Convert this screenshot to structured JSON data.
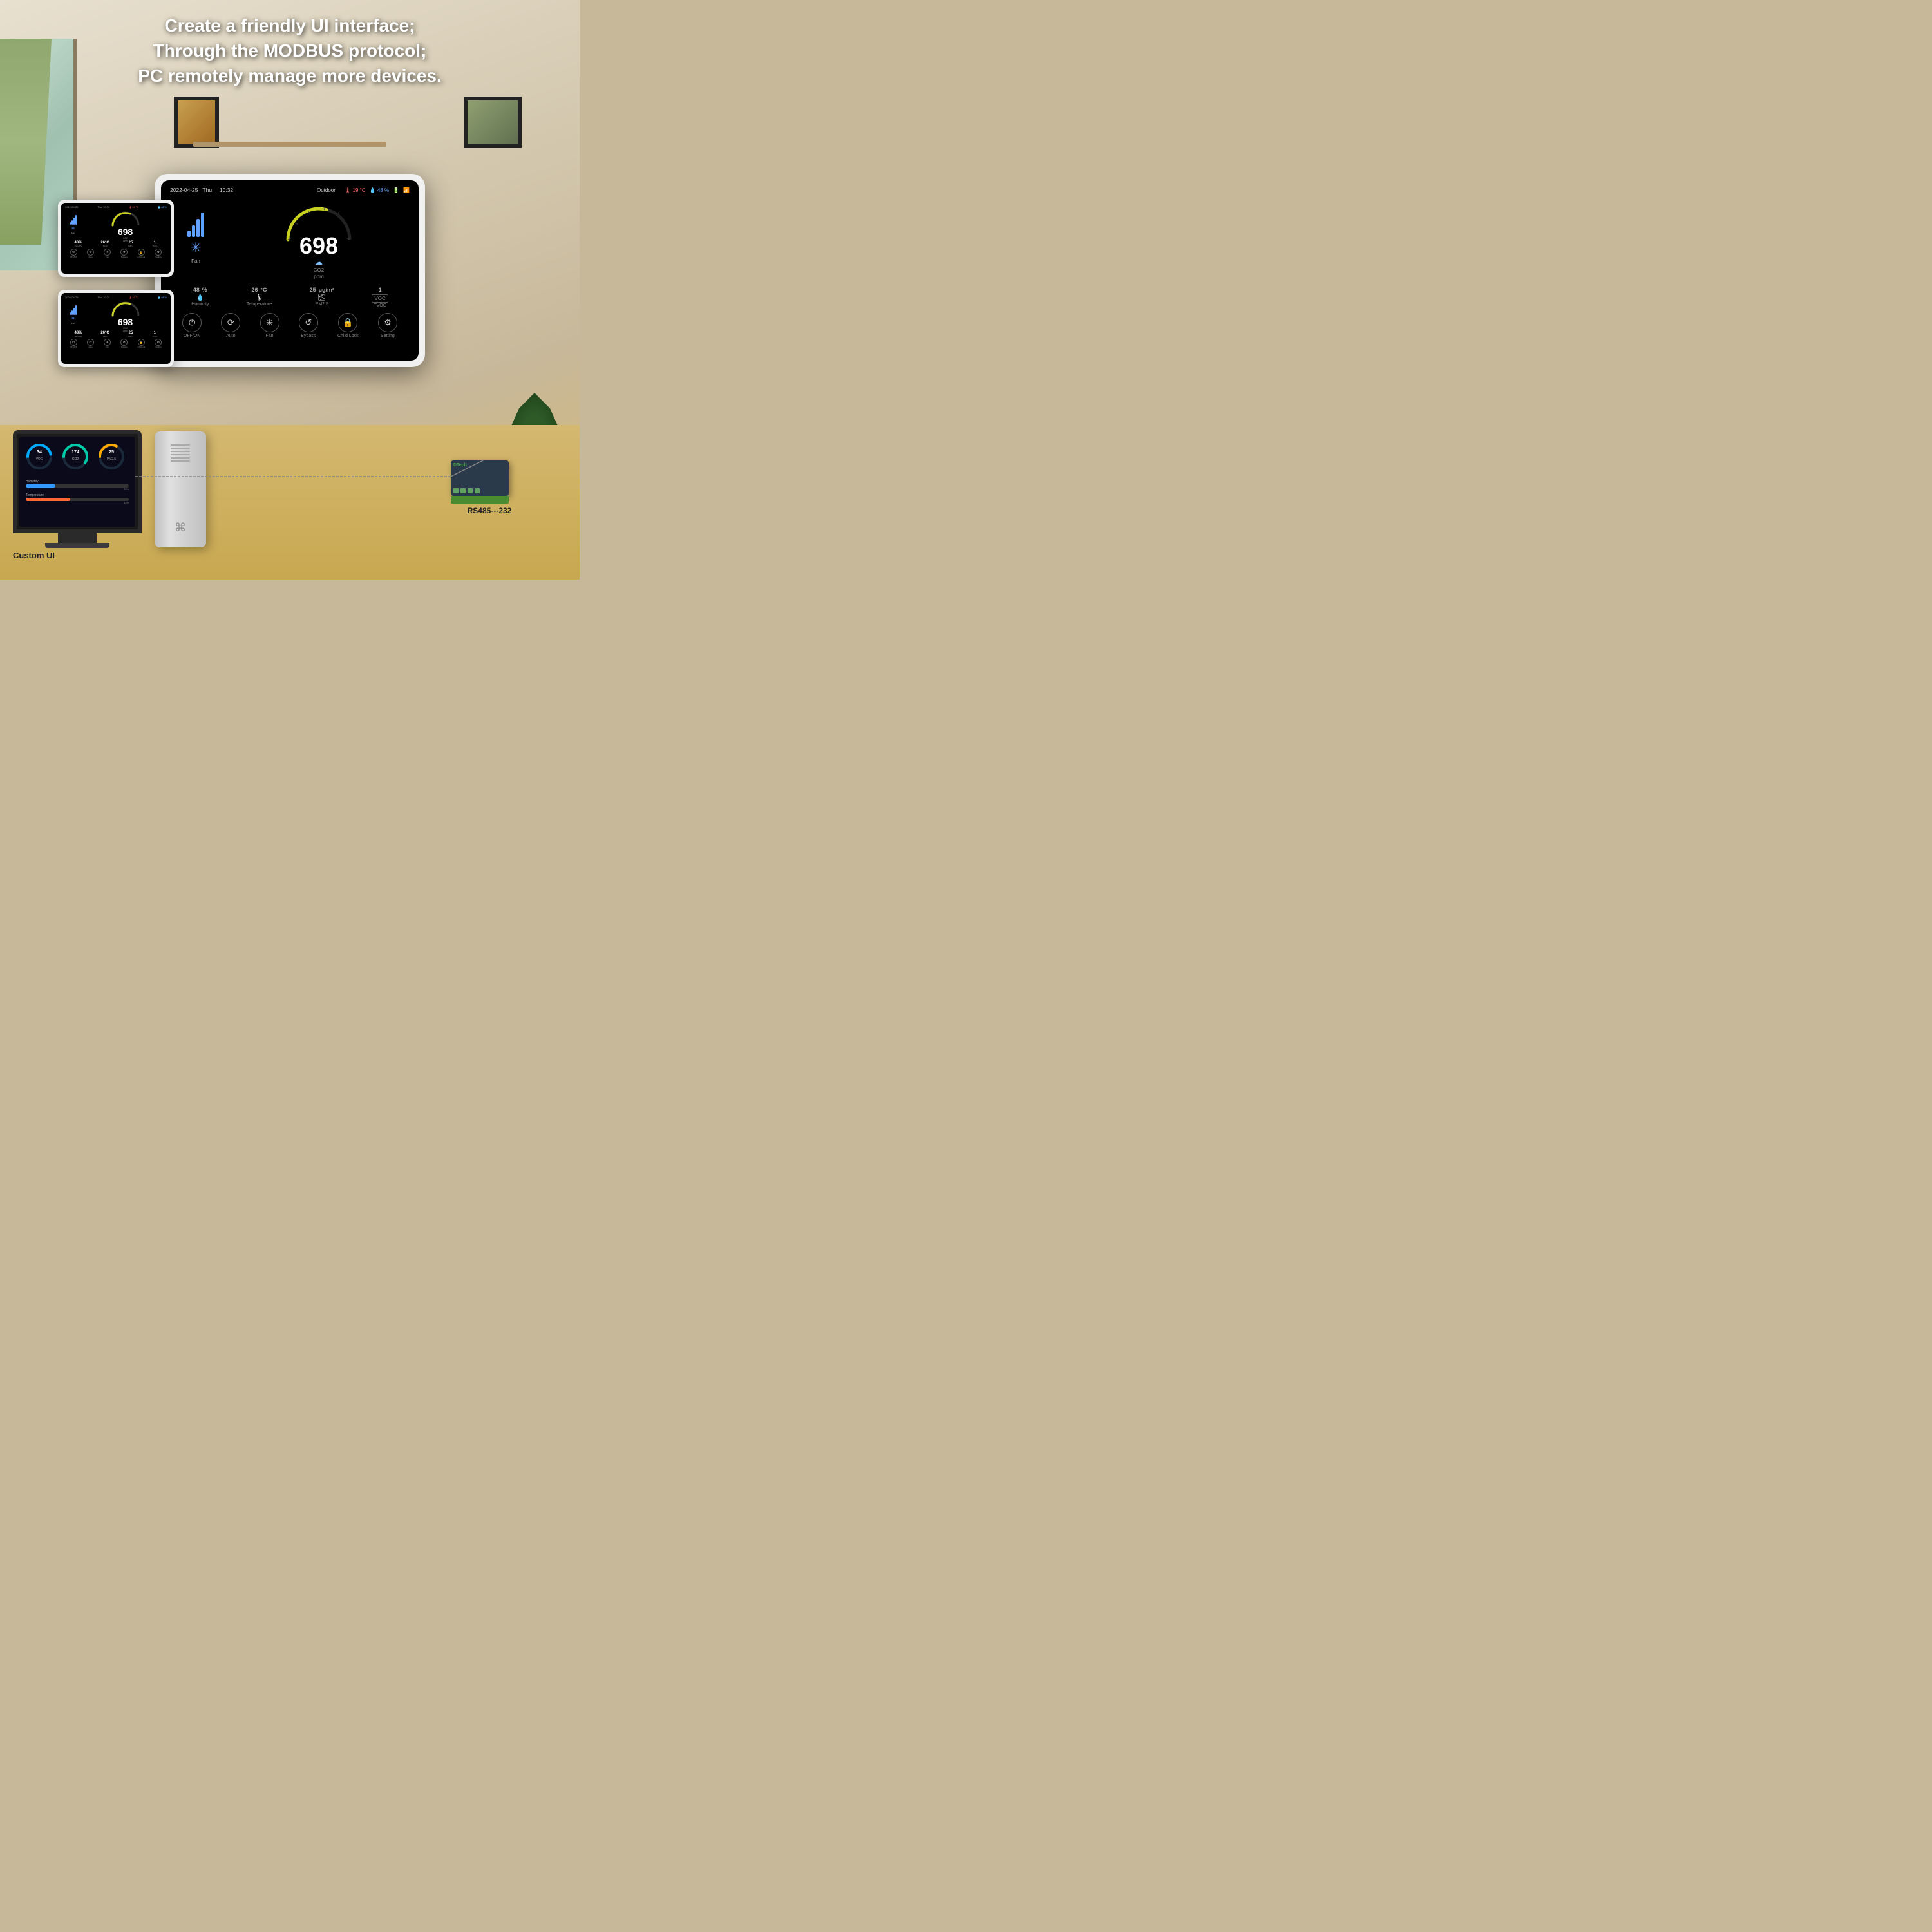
{
  "header": {
    "line1": "Create a friendly UI interface;",
    "line2": "Through the MODBUS protocol;",
    "line3": "PC remotely manage more devices."
  },
  "main_device": {
    "date": "2022-04-25",
    "day": "Thu.",
    "time": "10:32",
    "outdoor_label": "Outdoor",
    "outdoor_temp": "19 °C",
    "outdoor_humid": "48 %",
    "co2_value": "698",
    "co2_unit": "CO2",
    "co2_ppm": "ppm",
    "humidity_value": "48",
    "humidity_unit": "%",
    "humidity_label": "Humidity",
    "temp_value": "26",
    "temp_unit": "°C",
    "temp_label": "Temperature",
    "pm25_value": "25",
    "pm25_unit": "μg/m³",
    "pm25_label": "PM2.5",
    "tvoc_value": "1",
    "tvoc_label": "TVOC",
    "fan_label": "Fan",
    "controls": [
      {
        "icon": "⏻",
        "label": "OFF/ON"
      },
      {
        "icon": "⟳",
        "label": "Auto"
      },
      {
        "icon": "✳",
        "label": "Fan"
      },
      {
        "icon": "↺",
        "label": "Bypass"
      },
      {
        "icon": "🔒",
        "label": "Child Lock"
      },
      {
        "icon": "⚙",
        "label": "Setting"
      }
    ]
  },
  "small_device_1": {
    "date": "2022-04-25",
    "day": "Thu. 10:32",
    "outdoor_temp": "19 °C",
    "outdoor_humid": "48 %",
    "co2_value": "698",
    "humidity_value": "48",
    "temp_value": "26",
    "pm25_value": "25",
    "tvoc_value": "1"
  },
  "small_device_2": {
    "date": "2022-04-25",
    "day": "Thu. 10:32",
    "outdoor_temp": "19 °C",
    "outdoor_humid": "48 %",
    "co2_value": "698",
    "humidity_value": "48",
    "temp_value": "26",
    "pm25_value": "25",
    "tvoc_value": "1"
  },
  "bottom": {
    "custom_ui_label": "Custom UI",
    "rs485_label": "RS485---232",
    "mac_gauges": [
      {
        "label": "VOC",
        "value": "34",
        "color": "#00aaff"
      },
      {
        "label": "CO2",
        "value": "174",
        "color": "#00ccaa"
      },
      {
        "label": "PM2.5",
        "value": "25",
        "color": "#ffaa00"
      }
    ],
    "mac_metrics": [
      {
        "name": "Humidity",
        "value": "29%",
        "pct": 29,
        "color": "#3399ff"
      },
      {
        "name": "Temperature",
        "value": "43%",
        "pct": 43,
        "color": "#ff6633"
      }
    ]
  }
}
